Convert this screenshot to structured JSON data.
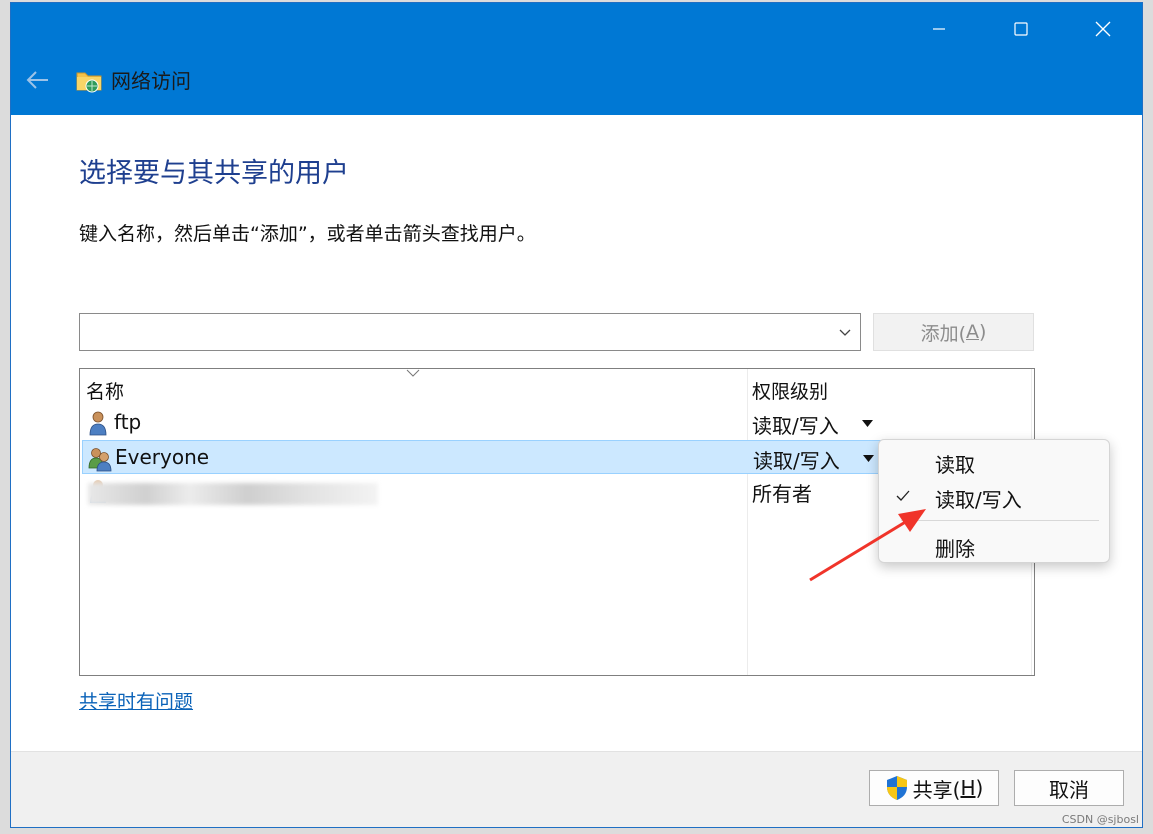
{
  "window": {
    "title": "网络访问"
  },
  "heading": "选择要与其共享的用户",
  "instruction": "键入名称，然后单击“添加”，或者单击箭头查找用户。",
  "user_input": {
    "value": "",
    "placeholder": ""
  },
  "add_button": {
    "label_prefix": "添加(",
    "accel": "A",
    "label_suffix": ")"
  },
  "list": {
    "columns": [
      "名称",
      "权限级别"
    ],
    "rows": [
      {
        "name": "ftp",
        "permission": "读取/写入",
        "icon": "user-icon"
      },
      {
        "name": "Everyone",
        "permission": "读取/写入",
        "icon": "group-icon",
        "selected": true
      },
      {
        "name": "",
        "permission": "所有者",
        "icon": "user-icon",
        "redacted": true
      }
    ]
  },
  "context_menu": {
    "items": [
      {
        "label": "读取",
        "checked": false
      },
      {
        "label": "读取/写入",
        "checked": true
      },
      {
        "label": "删除",
        "checked": false
      }
    ]
  },
  "help_link": "共享时有问题",
  "footer": {
    "share_prefix": "共享(",
    "share_accel": "H",
    "share_suffix": ")",
    "cancel": "取消"
  },
  "watermark": "CSDN @sjbosl",
  "colors": {
    "titlebar": "#0078d4",
    "heading": "#1e3f8f",
    "link": "#0a62b8",
    "selection": "#cce8ff",
    "annotation_arrow": "#f0342a"
  }
}
